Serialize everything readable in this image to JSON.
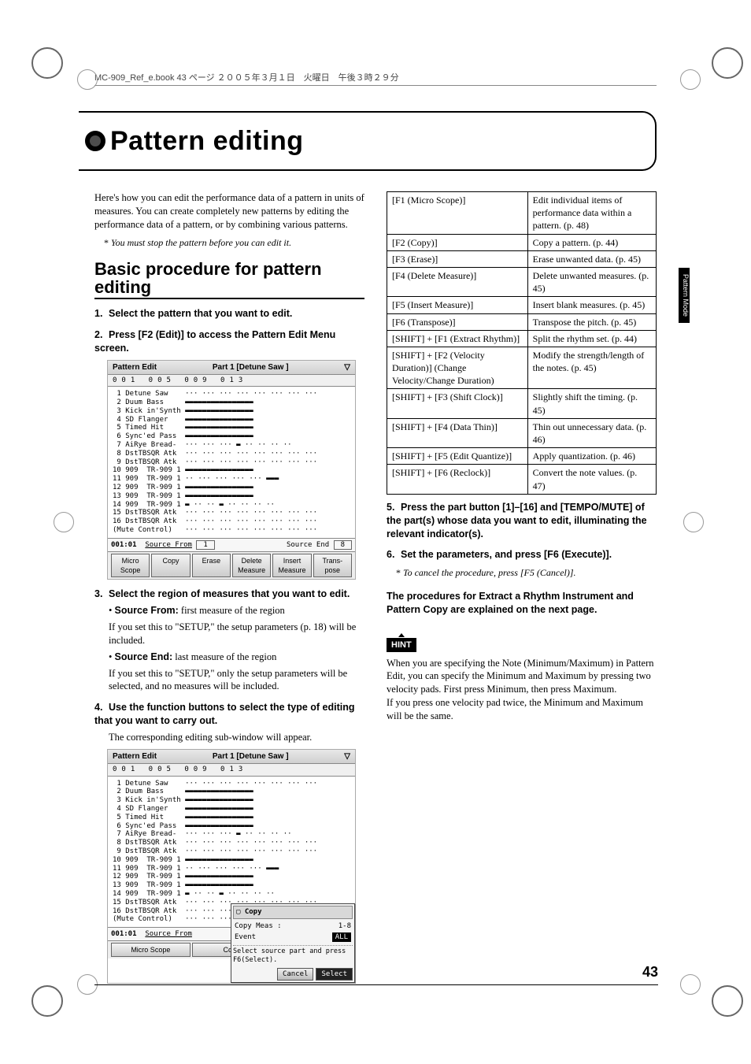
{
  "header": "MC-909_Ref_e.book  43 ページ  ２００５年３月１日　火曜日　午後３時２９分",
  "title": "Pattern editing",
  "side_tab": "Pattern Mode",
  "page_number": "43",
  "intro": {
    "p1": "Here's how you can edit the performance data of a pattern in units of measures. You can create completely new patterns by editing the performance data of a pattern, or by combining various patterns.",
    "note": "You must stop the pattern before you can edit it."
  },
  "section_heading": "Basic procedure for pattern editing",
  "steps": {
    "s1": "Select the pattern that you want to edit.",
    "s2": "Press [F2 (Edit)] to access the Pattern Edit Menu screen.",
    "s3": "Select the region of measures that you want to edit.",
    "s3_b1_label": "Source From:",
    "s3_b1_text": " first measure of the region",
    "s3_b1_sub": "If you set this to \"SETUP,\" the setup parameters (p. 18) will be included.",
    "s3_b2_label": "Source End:",
    "s3_b2_text": " last measure of the region",
    "s3_b2_sub": "If you set this to \"SETUP,\" only the setup parameters will be selected, and no measures will be included.",
    "s4": "Use the function buttons to select the type of editing that you want to carry out.",
    "s4_sub": "The corresponding editing sub-window will appear.",
    "s5": "Press the part button [1]–[16] and [TEMPO/MUTE] of the part(s) whose data you want to edit, illuminating the relevant indicator(s).",
    "s6": "Set the parameters, and press [F6 (Execute)].",
    "s6_note": "To cancel the procedure, press [F5 (Cancel)].",
    "final_bold": "The procedures for Extract a Rhythm Instrument and Pattern Copy are explained on the next page."
  },
  "fn_table": [
    [
      "[F1 (Micro Scope)]",
      "Edit individual items of performance data within a pattern. (p. 48)"
    ],
    [
      "[F2 (Copy)]",
      "Copy a pattern. (p. 44)"
    ],
    [
      "[F3 (Erase)]",
      "Erase unwanted data. (p. 45)"
    ],
    [
      "[F4 (Delete Measure)]",
      "Delete unwanted measures. (p. 45)"
    ],
    [
      "[F5 (Insert Measure)]",
      "Insert blank measures. (p. 45)"
    ],
    [
      "[F6 (Transpose)]",
      "Transpose the pitch. (p. 45)"
    ],
    [
      "[SHIFT] + [F1 (Extract Rhythm)]",
      "Split the rhythm set. (p. 44)"
    ],
    [
      "[SHIFT] + [F2 (Velocity Duration)] (Change Velocity/Change Duration)",
      "Modify the strength/length of the notes. (p. 45)"
    ],
    [
      "[SHIFT] + [F3 (Shift Clock)]",
      "Slightly shift the timing. (p. 45)"
    ],
    [
      "[SHIFT] + [F4 (Data Thin)]",
      "Thin out unnecessary data. (p. 46)"
    ],
    [
      "[SHIFT] + [F5 (Edit Quantize)]",
      "Apply quantization. (p. 46)"
    ],
    [
      "[SHIFT] + [F6 (Reclock)]",
      "Convert the note values. (p. 47)"
    ]
  ],
  "hint_label": "HINT",
  "hint_text1": "When you are specifying the Note (Minimum/Maximum) in Pattern Edit, you can specify the Minimum and Maximum by pressing two velocity pads. First press Minimum, then press Maximum.",
  "hint_text2": "If you press one velocity pad twice, the Minimum and Maximum will be the same.",
  "screenshot1": {
    "title_left": "Pattern Edit",
    "title_right": "Part 1   [Detune Saw   ]",
    "ruler": "001   005   009   013",
    "tracks": [
      " 1 Detune Saw    ··· ··· ··· ··· ··· ··· ··· ···",
      " 2 Duum Bass     ▬▬▬▬▬▬▬▬▬▬▬▬▬▬▬▬",
      " 3 Kick in'Synth ▬▬▬▬▬▬▬▬▬▬▬▬▬▬▬▬",
      " 4 SD Flanger    ▬▬▬▬▬▬▬▬▬▬▬▬▬▬▬▬",
      " 5 Timed Hit     ▬▬▬▬▬▬▬▬▬▬▬▬▬▬▬▬",
      " 6 Sync'ed Pass  ▬▬▬▬▬▬▬▬▬▬▬▬▬▬▬▬",
      " 7 AiRye Bread-  ··· ··· ··· ▬ ·· ·· ·· ··",
      " 8 DstTBSQR Atk  ··· ··· ··· ··· ··· ··· ··· ···",
      " 9 DstTBSQR Atk  ··· ··· ··· ··· ··· ··· ··· ···",
      "10 909  TR-909 1 ▬▬▬▬▬▬▬▬▬▬▬▬▬▬▬▬",
      "11 909  TR-909 1 ·· ··· ··· ··· ··· ▬▬▬",
      "12 909  TR-909 1 ▬▬▬▬▬▬▬▬▬▬▬▬▬▬▬▬",
      "13 909  TR-909 1 ▬▬▬▬▬▬▬▬▬▬▬▬▬▬▬▬",
      "14 909  TR-909 1 ▬ ·· ·· ▬ ·· ·· ·· ··",
      "15 DstTBSQR Atk  ··· ··· ··· ··· ··· ··· ··· ···",
      "16 DstTBSQR Atk  ··· ··· ··· ··· ··· ··· ··· ···",
      "(Mute Control)   ··· ··· ··· ··· ··· ··· ··· ···"
    ],
    "counter": "001:01",
    "source_from_label": "Source From",
    "source_from_val": "1",
    "source_end_label": "Source End",
    "source_end_val": "8",
    "buttons": [
      "Micro Scope",
      "Copy",
      "Erase",
      "Delete Measure",
      "Insert Measure",
      "Trans-pose"
    ]
  },
  "screenshot2": {
    "popup_title": "Copy",
    "popup_row1_l": "Copy Meas :",
    "popup_row1_r": "1-8",
    "popup_row2_l": "Event",
    "popup_row2_r": "ALL",
    "popup_msg": "Select source part and press F6(Select).",
    "popup_cancel": "Cancel",
    "popup_select": "Select"
  }
}
